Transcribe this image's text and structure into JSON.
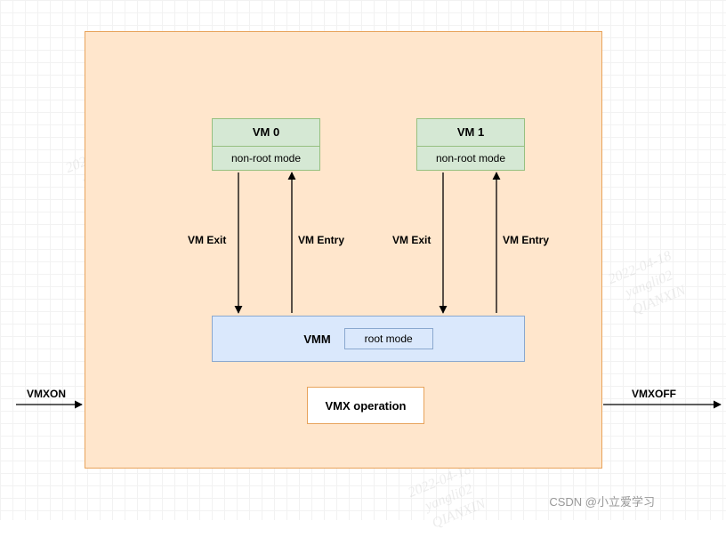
{
  "diagram": {
    "container_label": "",
    "vm0": {
      "title": "VM 0",
      "mode": "non-root mode"
    },
    "vm1": {
      "title": "VM 1",
      "mode": "non-root mode"
    },
    "vmm": {
      "label": "VMM",
      "root_mode": "root mode"
    },
    "vmx_op": "VMX operation",
    "arrows": {
      "vm0_exit": "VM Exit",
      "vm0_entry": "VM Entry",
      "vm1_exit": "VM Exit",
      "vm1_entry": "VM Entry",
      "left_in": "VMXON",
      "right_out": "VMXOFF"
    }
  },
  "watermark": {
    "line1": "2022-04-18",
    "line2": "yangli02",
    "line3": "QIANXIN"
  },
  "credit": "CSDN @小立爱学习"
}
